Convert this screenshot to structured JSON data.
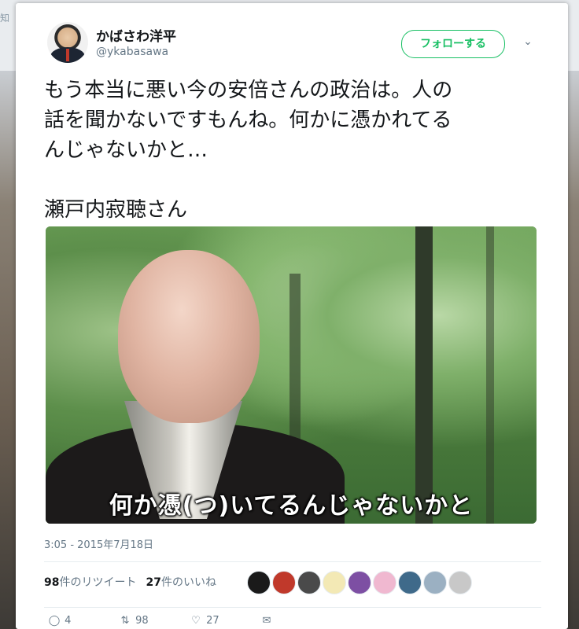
{
  "backdrop": {
    "label": "知"
  },
  "user": {
    "display_name": "かばさわ洋平",
    "handle": "@ykabasawa"
  },
  "follow_button": {
    "label": "フォローする"
  },
  "tweet": {
    "text": "もう本当に悪い今の安倍さんの政治は。人の\n話を聞かないですもんね。何かに憑かれてる\nんじゃないかと…\n\n瀬戸内寂聴さん",
    "media_subtitle": "何か憑(つ)いてるんじゃないかと",
    "timestamp": "3:05 - 2015年7月18日"
  },
  "stats": {
    "retweets_count": "98",
    "retweets_label": "件のリツイート",
    "likes_count": "27",
    "likes_label": "件のいいね"
  },
  "likers": [
    {
      "color": "#1a1a1a"
    },
    {
      "color": "#c0392b"
    },
    {
      "color": "#4a4a4a"
    },
    {
      "color": "#f3e9b5"
    },
    {
      "color": "#7d4fa3"
    },
    {
      "color": "#f0b8d0"
    },
    {
      "color": "#3f6a8a"
    },
    {
      "color": "#9bb0c2"
    },
    {
      "color": "#c8c8c8"
    }
  ],
  "actions": {
    "reply_count": "4",
    "retweet_count": "98",
    "like_count": "27",
    "icons": [
      "reply-icon",
      "retweet-icon",
      "like-icon",
      "message-icon"
    ]
  }
}
